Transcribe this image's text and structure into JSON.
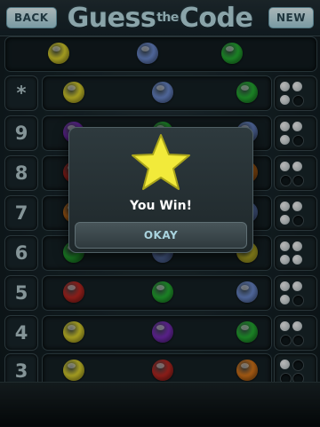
{
  "header": {
    "back_label": "BACK",
    "title_part1": "Guess",
    "title_small": "the",
    "title_part2": "Code",
    "new_label": "NEW"
  },
  "colors": {
    "yellow": "#e3d92f",
    "blue": "#6f8fd6",
    "green": "#27b535",
    "red": "#c22a24",
    "purple": "#7c2fbf",
    "orange": "#e07b1b"
  },
  "secret_code": [
    "yellow",
    "blue",
    "green"
  ],
  "rows": [
    {
      "label": "*",
      "pegs": [
        "yellow",
        "blue",
        "green"
      ],
      "hints": [
        "white",
        "white",
        "white",
        "empty"
      ]
    },
    {
      "label": "9",
      "pegs": [
        "purple",
        "green",
        "blue"
      ],
      "hints": [
        "white",
        "white",
        "white",
        "empty"
      ]
    },
    {
      "label": "8",
      "pegs": [
        "red",
        "yellow",
        "orange"
      ],
      "hints": [
        "white",
        "white",
        "empty",
        "empty"
      ]
    },
    {
      "label": "7",
      "pegs": [
        "orange",
        "red",
        "blue"
      ],
      "hints": [
        "white",
        "white",
        "white",
        "empty"
      ]
    },
    {
      "label": "6",
      "pegs": [
        "green",
        "blue",
        "yellow"
      ],
      "hints": [
        "white",
        "white",
        "white",
        "white"
      ]
    },
    {
      "label": "5",
      "pegs": [
        "red",
        "green",
        "blue"
      ],
      "hints": [
        "white",
        "white",
        "white",
        "empty"
      ]
    },
    {
      "label": "4",
      "pegs": [
        "yellow",
        "purple",
        "green"
      ],
      "hints": [
        "white",
        "white",
        "empty",
        "empty"
      ]
    },
    {
      "label": "3",
      "pegs": [
        "yellow",
        "red",
        "orange"
      ],
      "hints": [
        "white",
        "empty",
        "empty",
        "empty"
      ]
    }
  ],
  "dialog": {
    "message": "You Win!",
    "button_label": "OKAY",
    "star_color": "#f2ea3a"
  }
}
